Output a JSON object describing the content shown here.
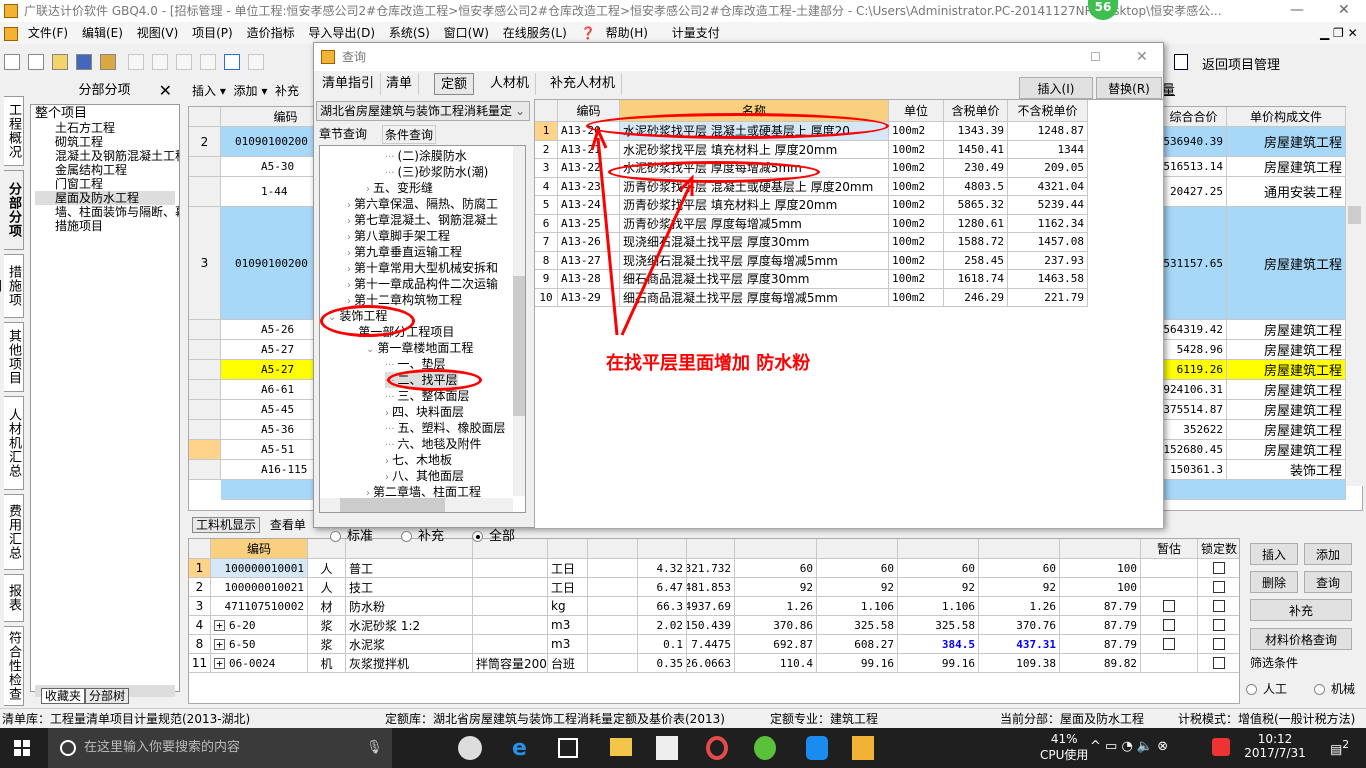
{
  "window": {
    "title": "广联达计价软件 GBQ4.0 - [招标管理 - 单位工程:恒安孝感公司2#仓库改造工程>恒安孝感公司2#仓库改造工程>恒安孝感公司2#仓库改造工程-土建部分 - C:\\Users\\Administrator.PC-20141127NRH...sktop\\恒安孝感公...",
    "badge": "56"
  },
  "menu": [
    "文件(F)",
    "编辑(E)",
    "视图(V)",
    "项目(P)",
    "造价指标",
    "导入导出(D)",
    "系统(S)",
    "窗口(W)",
    "在线服务(L)",
    "帮助(H)",
    "计量支付"
  ],
  "toolbar": {
    "return_label": "返回项目管理"
  },
  "vtabs": [
    "工程概况",
    "分部分项",
    "措施项目",
    "其他项目",
    "人材机汇总",
    "费用汇总",
    "报表",
    "符合性检查"
  ],
  "side": {
    "title": "分部分项",
    "root": "整个项目",
    "items": [
      "土石方工程",
      "砌筑工程",
      "混凝土及钢筋混凝土工程",
      "金属结构工程",
      "门窗工程",
      "屋面及防水工程",
      "墙、柱面装饰与隔断、幕",
      "措施项目"
    ],
    "selected": "屋面及防水工程",
    "bottom_tabs": [
      "收藏夹",
      "分部树"
    ]
  },
  "main_toolbar": {
    "insert": "插入",
    "add": "添加",
    "supplement": "补充",
    "quantity": "工程量"
  },
  "main_grid": {
    "headers": {
      "code": "编码",
      "total": "综合合价",
      "file": "单价构成文件"
    },
    "rows": [
      {
        "num": "2",
        "code": "01090100200",
        "total": "536940.39",
        "file": "房屋建筑工程",
        "style": "blue"
      },
      {
        "num": "",
        "code": "A5-30",
        "total": "516513.14",
        "file": "房屋建筑工程",
        "style": "white"
      },
      {
        "num": "",
        "code": "1-44",
        "total": "20427.25",
        "file": "通用安装工程",
        "style": "white"
      },
      {
        "num": "3",
        "code": "01090100200",
        "total": "3531157.65",
        "file": "房屋建筑工程",
        "style": "blue"
      },
      {
        "num": "",
        "code": "A5-26",
        "total": "564319.42",
        "file": "房屋建筑工程",
        "style": "white"
      },
      {
        "num": "",
        "code": "A5-27",
        "total": "5428.96",
        "file": "房屋建筑工程",
        "style": "white"
      },
      {
        "num": "",
        "code": "A5-27",
        "total": "6119.26",
        "file": "房屋建筑工程",
        "style": "yellow"
      },
      {
        "num": "",
        "code": "A6-61",
        "total": "1924106.31",
        "file": "房屋建筑工程",
        "style": "white"
      },
      {
        "num": "",
        "code": "A5-45",
        "total": "375514.87",
        "file": "房屋建筑工程",
        "style": "white"
      },
      {
        "num": "",
        "code": "A5-36",
        "total": "352622",
        "file": "房屋建筑工程",
        "style": "white"
      },
      {
        "num": "",
        "code": "A5-51",
        "total": "152680.45",
        "file": "房屋建筑工程",
        "style": "orange"
      },
      {
        "num": "",
        "code": "A16-115",
        "total": "150361.3",
        "file": "装饰工程",
        "style": "white"
      }
    ]
  },
  "bottom": {
    "tabs": [
      "工料机显示",
      "查看单"
    ],
    "headers": {
      "code": "编码",
      "temp": "暂估",
      "lock": "锁定数"
    },
    "rows": [
      {
        "n": "1",
        "code": "100000010001",
        "t": "人",
        "name": "普工",
        "spec": "",
        "unit": "工日",
        "a": "",
        "b": "4.32",
        "c": "321.732",
        "d": "60",
        "e": "60",
        "f": "60",
        "g": "60",
        "h": "100",
        "temp": false
      },
      {
        "n": "2",
        "code": "100000010021",
        "t": "人",
        "name": "技工",
        "spec": "",
        "unit": "工日",
        "a": "",
        "b": "6.47",
        "c": "481.853",
        "d": "92",
        "e": "92",
        "f": "92",
        "g": "92",
        "h": "100",
        "temp": false
      },
      {
        "n": "3",
        "code": "471107510002",
        "t": "材",
        "name": "防水粉",
        "spec": "",
        "unit": "kg",
        "a": "",
        "b": "66.3",
        "c": "4937.69",
        "d": "1.26",
        "e": "1.106",
        "f": "1.106",
        "g": "1.26",
        "h": "87.79",
        "temp": true
      },
      {
        "n": "4",
        "code": "6-20",
        "t": "浆",
        "name": "水泥砂浆 1:2",
        "spec": "",
        "unit": "m3",
        "a": "",
        "b": "2.02",
        "c": "150.439",
        "d": "370.86",
        "e": "325.58",
        "f": "325.58",
        "g": "370.76",
        "h": "87.79",
        "temp": true,
        "plus": true
      },
      {
        "n": "8",
        "code": "6-50",
        "t": "浆",
        "name": "水泥浆",
        "spec": "",
        "unit": "m3",
        "a": "",
        "b": "0.1",
        "c": "7.4475",
        "d": "692.87",
        "e": "608.27",
        "f": "384.5",
        "g": "437.31",
        "h": "87.79",
        "temp": true,
        "plus": true,
        "blue": true
      },
      {
        "n": "11",
        "code": "06-0024",
        "t": "机",
        "name": "灰浆搅拌机",
        "spec": "拌筒容量200",
        "unit": "台班",
        "a": "",
        "b": "0.35",
        "c": "26.0663",
        "d": "110.4",
        "e": "99.16",
        "f": "99.16",
        "g": "109.38",
        "h": "89.82",
        "temp": false,
        "plus": true
      }
    ],
    "buttons": {
      "insert": "插入",
      "add": "添加",
      "delete": "删除",
      "query": "查询",
      "supplement": "补充",
      "price_query": "材料价格查询"
    },
    "filter": {
      "title": "筛选条件",
      "labor": "人工",
      "machine": "机械"
    }
  },
  "dialog": {
    "title": "查询",
    "tabs": [
      "清单指引",
      "清单",
      "定额",
      "人材机",
      "补充人材机"
    ],
    "active_tab": "定额",
    "insert": "插入(I)",
    "replace": "替换(R)",
    "library": "湖北省房屋建筑与装饰工程消耗量定",
    "subtabs": [
      "章节查询",
      "条件查询"
    ],
    "tree": [
      {
        "label": "(二)涂膜防水",
        "lv": 4,
        "exp": ""
      },
      {
        "label": "(三)砂浆防水(潮)",
        "lv": 4,
        "exp": ""
      },
      {
        "label": "五、变形缝",
        "lv": 3,
        "exp": ">"
      },
      {
        "label": "第六章保温、隔热、防腐工",
        "lv": 2,
        "exp": ">"
      },
      {
        "label": "第七章混凝土、钢筋混凝土",
        "lv": 2,
        "exp": ">"
      },
      {
        "label": "第八章脚手架工程",
        "lv": 2,
        "exp": ">"
      },
      {
        "label": "第九章垂直运输工程",
        "lv": 2,
        "exp": ">"
      },
      {
        "label": "第十章常用大型机械安拆和",
        "lv": 2,
        "exp": ">"
      },
      {
        "label": "第十一章成品构件二次运输",
        "lv": 2,
        "exp": ">"
      },
      {
        "label": "第十二章构筑物工程",
        "lv": 2,
        "exp": ">"
      },
      {
        "label": "装饰工程",
        "lv": 1,
        "exp": "v"
      },
      {
        "label": "第一部分工程项目",
        "lv": 2,
        "exp": "v"
      },
      {
        "label": "第一章楼地面工程",
        "lv": 3,
        "exp": "v"
      },
      {
        "label": "一、垫层",
        "lv": 4,
        "exp": ""
      },
      {
        "label": "二、找平层",
        "lv": 4,
        "exp": "",
        "sel": true
      },
      {
        "label": "三、整体面层",
        "lv": 4,
        "exp": ""
      },
      {
        "label": "四、块料面层",
        "lv": 4,
        "exp": ">"
      },
      {
        "label": "五、塑料、橡胶面层",
        "lv": 4,
        "exp": ""
      },
      {
        "label": "六、地毯及附件",
        "lv": 4,
        "exp": ""
      },
      {
        "label": "七、木地板",
        "lv": 4,
        "exp": ">"
      },
      {
        "label": "八、其他面层",
        "lv": 4,
        "exp": ">"
      },
      {
        "label": "第二章墙、柱面工程",
        "lv": 3,
        "exp": ">"
      }
    ],
    "radios": [
      {
        "label": "标准",
        "on": false
      },
      {
        "label": "补充",
        "on": false
      },
      {
        "label": "全部",
        "on": true
      }
    ],
    "grid_headers": [
      "编码",
      "名称",
      "单位",
      "含税单价",
      "不含税单价"
    ],
    "rows": [
      {
        "n": "1",
        "code": "A13-20",
        "name": "水泥砂浆找平层 混凝土或硬基层上 厚度20",
        "unit": "100m2",
        "tax": "1343.39",
        "notax": "1248.87"
      },
      {
        "n": "2",
        "code": "A13-21",
        "name": "水泥砂浆找平层 填充材料上 厚度20mm",
        "unit": "100m2",
        "tax": "1450.41",
        "notax": "1344"
      },
      {
        "n": "3",
        "code": "A13-22",
        "name": "水泥砂浆找平层 厚度每增减5mm",
        "unit": "100m2",
        "tax": "230.49",
        "notax": "209.05"
      },
      {
        "n": "4",
        "code": "A13-23",
        "name": "沥青砂浆找平层 混凝土或硬基层上 厚度20mm",
        "unit": "100m2",
        "tax": "4803.5",
        "notax": "4321.04"
      },
      {
        "n": "5",
        "code": "A13-24",
        "name": "沥青砂浆找平层 填充材料上 厚度20mm",
        "unit": "100m2",
        "tax": "5865.32",
        "notax": "5239.44"
      },
      {
        "n": "6",
        "code": "A13-25",
        "name": "沥青砂浆找平层 厚度每增减5mm",
        "unit": "100m2",
        "tax": "1280.61",
        "notax": "1162.34"
      },
      {
        "n": "7",
        "code": "A13-26",
        "name": "现浇细石混凝土找平层 厚度30mm",
        "unit": "100m2",
        "tax": "1588.72",
        "notax": "1457.08"
      },
      {
        "n": "8",
        "code": "A13-27",
        "name": "现浇细石混凝土找平层 厚度每增减5mm",
        "unit": "100m2",
        "tax": "258.45",
        "notax": "237.93"
      },
      {
        "n": "9",
        "code": "A13-28",
        "name": "细石商品混凝土找平层 厚度30mm",
        "unit": "100m2",
        "tax": "1618.74",
        "notax": "1463.58"
      },
      {
        "n": "10",
        "code": "A13-29",
        "name": "细石商品混凝土找平层 厚度每增减5mm",
        "unit": "100m2",
        "tax": "246.29",
        "notax": "221.79"
      }
    ]
  },
  "annotation": {
    "text": "在找平层里面增加 防水粉",
    "color": "#ff0000"
  },
  "status": {
    "list_lib": "清单库：工程量清单项目计量规范(2013-湖北)",
    "quota_lib": "定额库：湖北省房屋建筑与装饰工程消耗量定额及基价表(2013)",
    "quota_major": "定额专业：建筑工程",
    "current": "当前分部：屋面及防水工程",
    "tax_mode": "计税模式：增值税(一般计税方法)"
  },
  "taskbar": {
    "search_placeholder": "在这里输入你要搜索的内容",
    "cpu_percent": "41%",
    "cpu_label": "CPU使用",
    "time": "10:12",
    "date": "2017/7/31",
    "notif_count": "2"
  },
  "colors": {
    "row_blue": "#a8d8f8",
    "row_yellow": "#ffff00",
    "row_orange": "#ffd38a",
    "header_orange": "#f8d080",
    "selected": "#d6e8f8"
  }
}
